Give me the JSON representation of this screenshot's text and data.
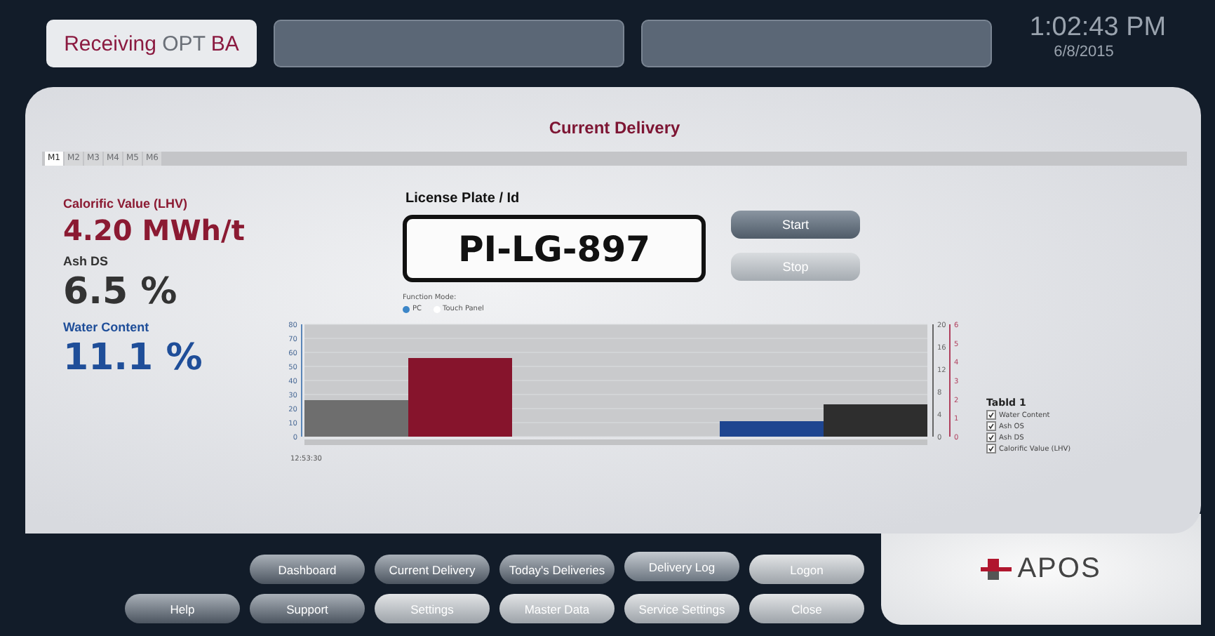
{
  "header": {
    "app_title": [
      {
        "text": "Receiving",
        "color": "#8b1a40"
      },
      {
        "text": "OPT",
        "color": "#6b7078"
      },
      {
        "text": "BA",
        "color": "#8b1a40"
      }
    ],
    "time": "1:02:43 PM",
    "date": "6/8/2015"
  },
  "panel": {
    "title": "Current Delivery",
    "tabs": [
      {
        "label": "M1",
        "selected": true
      },
      {
        "label": "M2",
        "selected": false
      },
      {
        "label": "M3",
        "selected": false
      },
      {
        "label": "M4",
        "selected": false
      },
      {
        "label": "M5",
        "selected": false
      },
      {
        "label": "M6",
        "selected": false
      }
    ],
    "readings": [
      {
        "label": "Calorific Value (LHV)",
        "value": "4.20 MWh/t",
        "color": "#8b1a32"
      },
      {
        "label": "Ash DS",
        "value": "6.5 %",
        "color": "#333333"
      },
      {
        "label": "Water Content",
        "value": "11.1 %",
        "color": "#1f4e99"
      }
    ],
    "license_plate": {
      "label": "License Plate / Id",
      "value": "PI-LG-897"
    },
    "actions": [
      {
        "label": "Start",
        "kind": "dark"
      },
      {
        "label": "Stop",
        "kind": "light"
      }
    ],
    "function_mode": {
      "label": "Function Mode:",
      "options": [
        {
          "label": "PC",
          "selected": true
        },
        {
          "label": "Touch Panel",
          "selected": false
        }
      ]
    },
    "chart_data": {
      "type": "bar",
      "grid": true,
      "ylim": [
        0,
        80
      ],
      "yticks": [
        0,
        10,
        20,
        30,
        40,
        50,
        60,
        70,
        80
      ],
      "xlabel": "12:53:30",
      "series": [
        {
          "color": "#6e6e6e",
          "values": [
            26,
            null,
            null,
            null,
            null,
            null
          ]
        },
        {
          "color": "#86142c",
          "values": [
            null,
            56,
            null,
            null,
            null,
            null
          ]
        },
        {
          "color": "#1e4590",
          "values": [
            null,
            null,
            null,
            null,
            11,
            null
          ]
        },
        {
          "color": "#2e2e2e",
          "values": [
            null,
            null,
            null,
            null,
            null,
            23
          ]
        }
      ]
    },
    "right_axes": [
      {
        "color": "#666666",
        "ticks": [
          "20",
          "16",
          "12",
          "8",
          "4",
          "0"
        ]
      },
      {
        "color": "#b0405e",
        "ticks": [
          "6",
          "5",
          "4",
          "3",
          "2",
          "1",
          "0"
        ]
      }
    ],
    "legend": {
      "title": "Tabld 1",
      "items": [
        {
          "label": "Water Content",
          "checked": true
        },
        {
          "label": "Ash OS",
          "checked": true
        },
        {
          "label": "Ash DS",
          "checked": true
        },
        {
          "label": "Calorific Value (LHV)",
          "checked": true
        }
      ]
    }
  },
  "nav_rows": [
    [
      {
        "label": "Dashboard",
        "kind": "dark"
      },
      {
        "label": "Current Delivery",
        "kind": "dark"
      },
      {
        "label": "Today's Deliveries",
        "kind": "dark"
      },
      {
        "label": "Delivery Log",
        "kind": "raised"
      },
      {
        "label": "Logon",
        "kind": "light"
      }
    ],
    [
      {
        "label": "Help",
        "kind": "dark"
      },
      {
        "label": "Support",
        "kind": "dark"
      },
      {
        "label": "Settings",
        "kind": "light"
      },
      {
        "label": "Master Data",
        "kind": "light"
      },
      {
        "label": "Service Settings",
        "kind": "light"
      },
      {
        "label": "Close",
        "kind": "light"
      }
    ]
  ],
  "logo": {
    "text": "APOS"
  }
}
